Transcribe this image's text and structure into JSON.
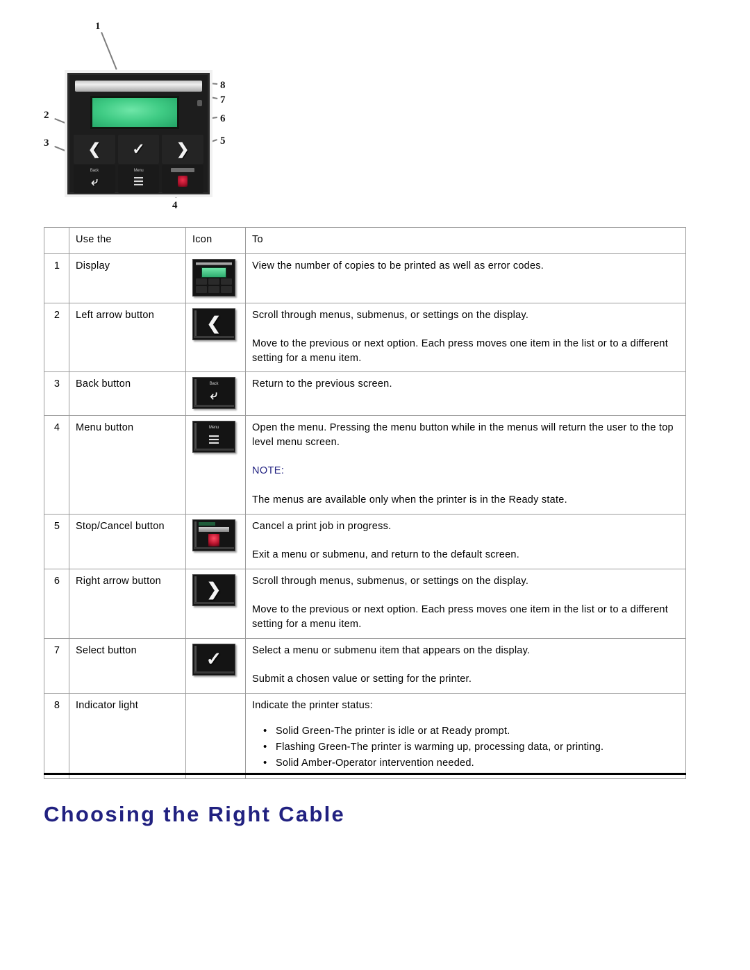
{
  "figure": {
    "alt_name": "printer-control-panel-diagram",
    "callouts": [
      "1",
      "2",
      "3",
      "4",
      "5",
      "6",
      "7",
      "8"
    ],
    "panel": {
      "left_arrow_glyph": "❮",
      "select_glyph": "✓",
      "right_arrow_glyph": "❯",
      "back_label": "Back",
      "menu_label": "Menu",
      "cancel_label": "Cancel"
    }
  },
  "table": {
    "headers": [
      "",
      "Use the",
      "Icon",
      "To"
    ],
    "rows": [
      {
        "num": "1",
        "use": "Display",
        "icon": "control-panel-display-icon",
        "paragraphs": [
          "View the number of copies to be printed as well as error codes."
        ]
      },
      {
        "num": "2",
        "use": "Left arrow button",
        "icon": "left-arrow-button-icon",
        "paragraphs": [
          "Scroll through menus, submenus, or settings on the display.",
          "Move to the previous or next option. Each press moves one item in the list or to a different setting for a menu item."
        ]
      },
      {
        "num": "3",
        "use": "Back button",
        "icon": "back-button-icon",
        "paragraphs": [
          "Return to the previous screen."
        ]
      },
      {
        "num": "4",
        "use": "Menu button",
        "icon": "menu-button-icon",
        "paragraphs": [
          "Open the menu. Pressing the menu button while in the menus will return the user to the top level menu screen."
        ],
        "note_label": "NOTE:",
        "note_body": "The menus are available only when the printer is in the Ready state."
      },
      {
        "num": "5",
        "use": "Stop/Cancel button",
        "icon": "stop-cancel-button-icon",
        "paragraphs": [
          "Cancel a print job in progress.",
          "Exit a menu or submenu, and return to the default screen."
        ]
      },
      {
        "num": "6",
        "use": "Right arrow button",
        "icon": "right-arrow-button-icon",
        "paragraphs": [
          "Scroll through menus, submenus, or settings on the display.",
          "Move to the previous or next option. Each press moves one item in the list or to a different setting for a menu item."
        ]
      },
      {
        "num": "7",
        "use": "Select button",
        "icon": "select-button-icon",
        "paragraphs": [
          "Select a menu or submenu item that appears on the display.",
          "Submit a chosen value or setting for the printer."
        ]
      },
      {
        "num": "8",
        "use": "Indicator light",
        "icon": null,
        "paragraphs": [
          "Indicate the printer status:"
        ],
        "bullets": [
          "Solid Green-The printer is idle or at Ready prompt.",
          "Flashing Green-The printer is warming up, processing data, or printing.",
          "Solid Amber-Operator intervention needed."
        ]
      }
    ]
  },
  "section": {
    "heading": "Choosing the Right Cable"
  },
  "colors": {
    "heading_blue": "#212180",
    "note_blue": "#212180",
    "rule_black": "#000000",
    "table_border": "#9b9b9b"
  }
}
